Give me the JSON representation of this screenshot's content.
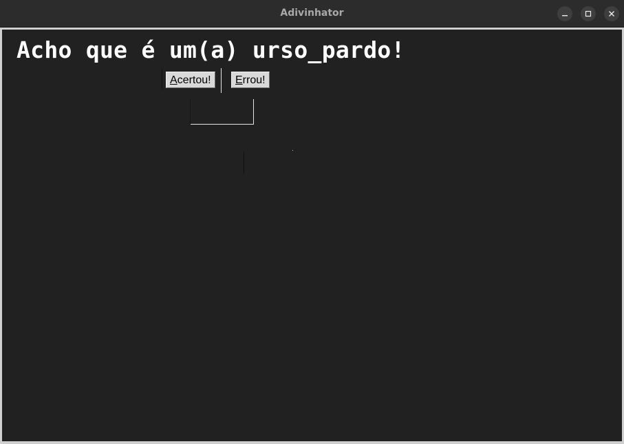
{
  "window": {
    "title": "Adivinhator",
    "controls": {
      "minimize": "minimize-icon",
      "maximize": "maximize-icon",
      "close": "close-icon"
    }
  },
  "content": {
    "message": "Acho que é um(a) urso_pardo!",
    "buttons": {
      "acertou": {
        "first": "A",
        "rest": "certou!"
      },
      "errou": {
        "first": "E",
        "rest": "rrou!"
      }
    }
  },
  "colors": {
    "background": "#212121",
    "titlebar": "#2c2c2c",
    "button_face": "#d9d9d9",
    "text": "#ffffff"
  }
}
